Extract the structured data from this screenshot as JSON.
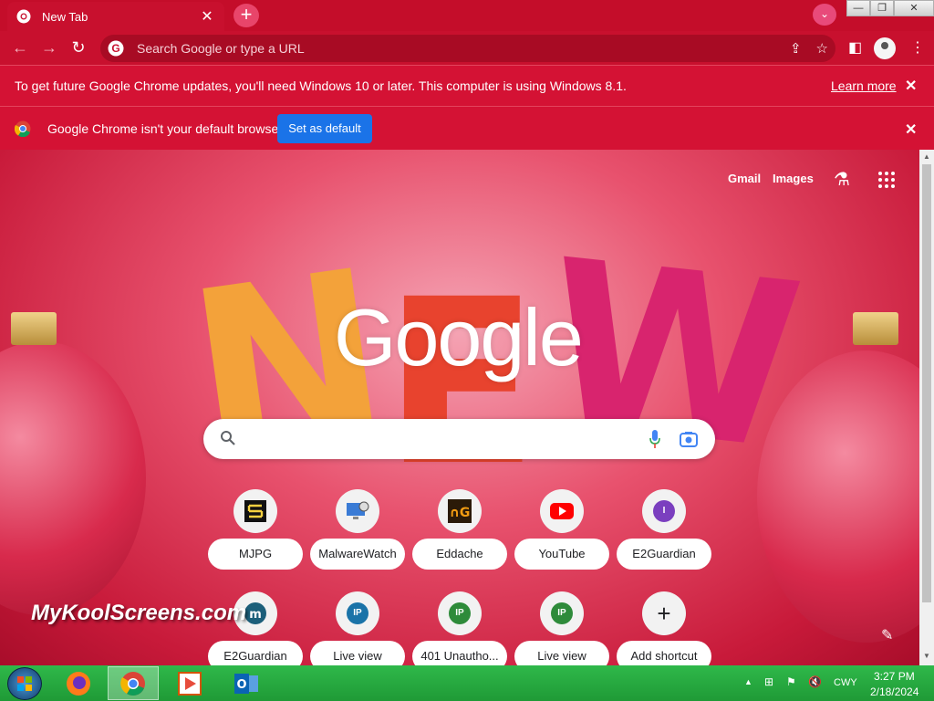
{
  "browser": {
    "tab_title": "New Tab",
    "tab_close": "✕",
    "new_tab": "+",
    "omnibox_placeholder": "Search Google or type a URL",
    "window_controls": {
      "minimize": "—",
      "restore": "❐",
      "close": "✕"
    }
  },
  "infobar_update": {
    "message": "To get future Google Chrome updates, you'll need Windows 10 or later. This computer is using Windows 8.1.",
    "link": "Learn more",
    "close": "✕"
  },
  "infobar_default": {
    "message": "Google Chrome isn't your default browser",
    "button": "Set as default",
    "close": "✕"
  },
  "ntp": {
    "links": {
      "gmail": "Gmail",
      "images": "Images"
    },
    "logo": "Google",
    "shortcuts": [
      {
        "label": "MJPG",
        "icon": "mjpg-icon"
      },
      {
        "label": "MalwareWatch",
        "icon": "malwarewatch-icon"
      },
      {
        "label": "Eddache",
        "icon": "eddache-icon"
      },
      {
        "label": "YouTube",
        "icon": "youtube-icon"
      },
      {
        "label": "E2Guardian",
        "icon": "letter-i-icon",
        "letter": "I"
      },
      {
        "label": "E2Guardian",
        "icon": "e2guardian-icon"
      },
      {
        "label": "Live view",
        "icon": "ip-icon",
        "letter": "IP",
        "color": "#1a73a8"
      },
      {
        "label": "401 Unautho...",
        "icon": "ip-icon",
        "letter": "IP",
        "color": "#2e8b3a"
      },
      {
        "label": "Live view",
        "icon": "ip-icon",
        "letter": "IP",
        "color": "#2e8b3a"
      },
      {
        "label": "Add shortcut",
        "icon": "plus-icon",
        "letter": "+"
      }
    ],
    "background_text": "NEW",
    "watermark": "MyKoolScreens.com"
  },
  "taskbar": {
    "time": "3:27 PM",
    "date": "2/18/2024",
    "language": "CWY"
  },
  "colors": {
    "chrome_red": "#c8102e",
    "blue_button": "#1a73e8",
    "taskbar_green": "#2fb84a"
  }
}
